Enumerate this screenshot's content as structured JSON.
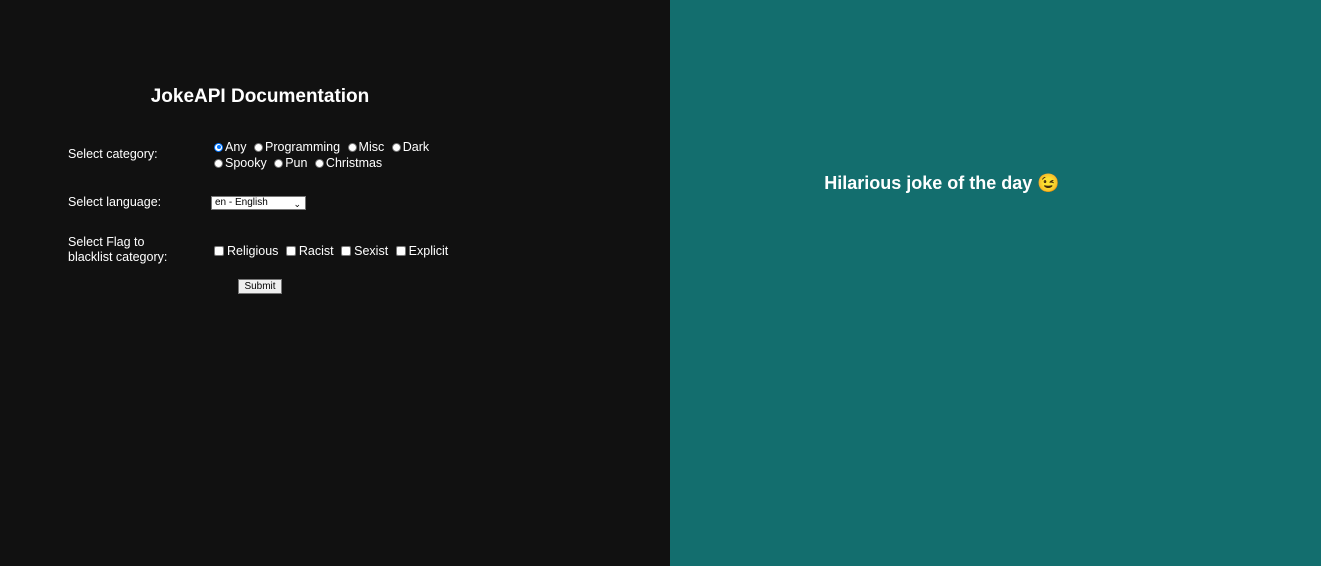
{
  "left": {
    "title": "JokeAPI Documentation",
    "category_label": "Select category:",
    "categories": [
      {
        "label": "Any",
        "checked": true
      },
      {
        "label": "Programming",
        "checked": false
      },
      {
        "label": "Misc",
        "checked": false
      },
      {
        "label": "Dark",
        "checked": false
      },
      {
        "label": "Spooky",
        "checked": false
      },
      {
        "label": "Pun",
        "checked": false
      },
      {
        "label": "Christmas",
        "checked": false
      }
    ],
    "language_label": "Select language:",
    "language_selected": "en - English",
    "flags_label": "Select Flag to blacklist category:",
    "flags": [
      {
        "label": "Religious",
        "checked": false
      },
      {
        "label": "Racist",
        "checked": false
      },
      {
        "label": "Sexist",
        "checked": false
      },
      {
        "label": "Explicit",
        "checked": false
      }
    ],
    "submit_label": "Submit"
  },
  "right": {
    "title": "Hilarious joke of the day 😉"
  },
  "colors": {
    "left_bg": "#111111",
    "right_bg": "#136e6e",
    "radio_accent": "#0075ff"
  }
}
